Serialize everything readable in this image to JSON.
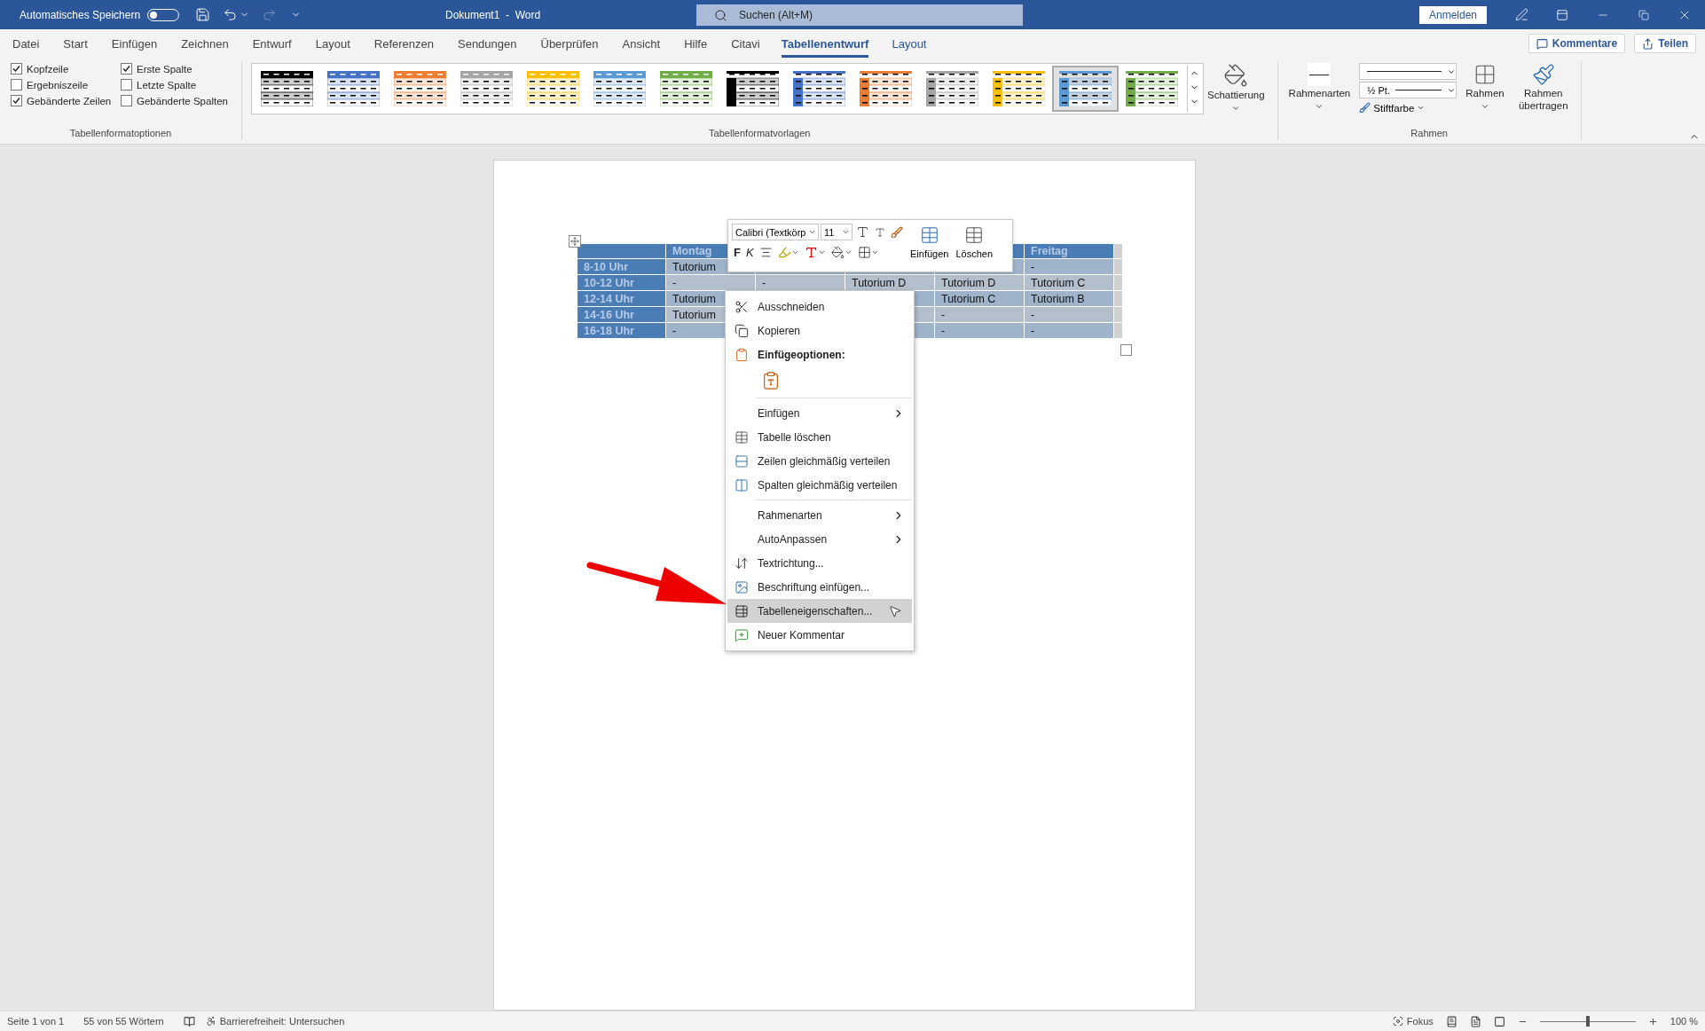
{
  "title_bar": {
    "autosave_label": "Automatisches Speichern",
    "autosave_on": false,
    "title": "Dokument1  -  Word",
    "search_placeholder": "Suchen (Alt+M)",
    "signin": "Anmelden"
  },
  "menu_tabs": [
    {
      "label": "Datei",
      "selected": false
    },
    {
      "label": "Start",
      "selected": false
    },
    {
      "label": "Einfügen",
      "selected": false
    },
    {
      "label": "Zeichnen",
      "selected": false
    },
    {
      "label": "Entwurf",
      "selected": false
    },
    {
      "label": "Layout",
      "selected": false
    },
    {
      "label": "Referenzen",
      "selected": false
    },
    {
      "label": "Sendungen",
      "selected": false
    },
    {
      "label": "Überprüfen",
      "selected": false
    },
    {
      "label": "Ansicht",
      "selected": false
    },
    {
      "label": "Hilfe",
      "selected": false
    },
    {
      "label": "Citavi",
      "selected": false
    },
    {
      "label": "Tabellenentwurf",
      "selected": true,
      "contextual": true
    },
    {
      "label": "Layout",
      "selected": false,
      "contextual": true
    }
  ],
  "ribbon_actions": [
    "Kommentare",
    "Teilen"
  ],
  "options": {
    "label": "Tabellenformatoptionen",
    "items": [
      {
        "label": "Kopfzeile",
        "checked": true
      },
      {
        "label": "Erste Spalte",
        "checked": true
      },
      {
        "label": "Ergebniszeile",
        "checked": false
      },
      {
        "label": "Letzte Spalte",
        "checked": false
      },
      {
        "label": "Gebänderte Zeilen",
        "checked": true
      },
      {
        "label": "Gebänderte Spalten",
        "checked": false
      }
    ]
  },
  "styles": {
    "label": "Tabellenformatvorlagen",
    "items": [
      {
        "kind": "header",
        "color": "#000000",
        "selected": false
      },
      {
        "kind": "header",
        "color": "#4472c4",
        "selected": false
      },
      {
        "kind": "header",
        "color": "#ed7d31",
        "selected": false
      },
      {
        "kind": "header",
        "color": "#a5a5a5",
        "selected": false
      },
      {
        "kind": "header",
        "color": "#ffc000",
        "selected": false
      },
      {
        "kind": "header",
        "color": "#5b9bd5",
        "selected": false
      },
      {
        "kind": "header",
        "color": "#70ad47",
        "selected": false
      },
      {
        "kind": "column",
        "color": "#000000",
        "selected": false
      },
      {
        "kind": "column",
        "color": "#4472c4",
        "selected": false
      },
      {
        "kind": "column",
        "color": "#ed7d31",
        "selected": false
      },
      {
        "kind": "column",
        "color": "#a5a5a5",
        "selected": false
      },
      {
        "kind": "column",
        "color": "#ffc000",
        "selected": false
      },
      {
        "kind": "column",
        "color": "#5b9bd5",
        "selected": true
      },
      {
        "kind": "column",
        "color": "#70ad47",
        "selected": false
      }
    ]
  },
  "shading": "Schattierung",
  "borders": {
    "label": "Rahmen",
    "styles": "Rahmenarten",
    "weight": "½ Pt.",
    "pen_color": "Stiftfarbe",
    "borders": "Rahmen",
    "painter": "Rahmen übertragen"
  },
  "table": {
    "header": {
      "column_2": "Montag",
      "column_6": "Freitag"
    },
    "rows": [
      [
        {
          "text": "8-10 Uhr"
        },
        {
          "text": "Tutorium"
        },
        {},
        {},
        {},
        {
          "text": "-"
        }
      ],
      [
        {
          "text": "10-12 Uhr"
        },
        {
          "text": "-"
        },
        {
          "text": "-"
        },
        {
          "text": "Tutorium D"
        },
        {
          "text": "Tutorium D"
        },
        {
          "text": "Tutorium C"
        }
      ],
      [
        {
          "text": "12-14 Uhr"
        },
        {
          "text": "Tutorium"
        },
        {},
        {},
        {
          "text": "Tutorium C"
        },
        {
          "text": "Tutorium B"
        }
      ],
      [
        {
          "text": "14-16 Uhr"
        },
        {
          "text": "Tutorium"
        },
        {},
        {},
        {
          "text": "-"
        },
        {
          "text": "-"
        }
      ],
      [
        {
          "text": "16-18 Uhr"
        },
        {
          "text": "-"
        },
        {},
        {},
        {
          "text": "-"
        },
        {
          "text": "-"
        }
      ]
    ]
  },
  "mini_toolbar": {
    "font": "Calibri (Textkörp",
    "size": "11",
    "bold": "F",
    "italic": "K",
    "insert": "Einfügen",
    "delete": "Löschen"
  },
  "context_menu": [
    {
      "kind": "item",
      "label": "Ausschneiden",
      "selected": false
    },
    {
      "kind": "item",
      "label": "Kopieren",
      "selected": false
    },
    {
      "kind": "header",
      "label": "Einfügeoptionen:"
    },
    {
      "kind": "paste"
    },
    {
      "kind": "separator"
    },
    {
      "kind": "submenu",
      "label": "Einfügen",
      "selected": false
    },
    {
      "kind": "item",
      "label": "Tabelle löschen",
      "selected": false
    },
    {
      "kind": "item",
      "label": "Zeilen gleichmäßig verteilen",
      "selected": false
    },
    {
      "kind": "item",
      "label": "Spalten gleichmäßig verteilen",
      "selected": false
    },
    {
      "kind": "separator"
    },
    {
      "kind": "submenu",
      "label": "Rahmenarten",
      "selected": false
    },
    {
      "kind": "submenu",
      "label": "AutoAnpassen",
      "selected": false
    },
    {
      "kind": "item",
      "label": "Textrichtung...",
      "selected": false
    },
    {
      "kind": "item",
      "label": "Beschriftung einfügen...",
      "selected": false
    },
    {
      "kind": "item",
      "label": "Tabelleneigenschaften...",
      "selected": true
    },
    {
      "kind": "item",
      "label": "Neuer Kommentar",
      "selected": false
    }
  ],
  "status_bar": {
    "page": "Seite 1 von 1",
    "words": "55 von 55 Wörtern",
    "accessibility": "Barrierefreiheit: Untersuchen",
    "focus": "Fokus",
    "zoom": "100 %",
    "zoom_slider": {
      "level": 0.5
    }
  }
}
